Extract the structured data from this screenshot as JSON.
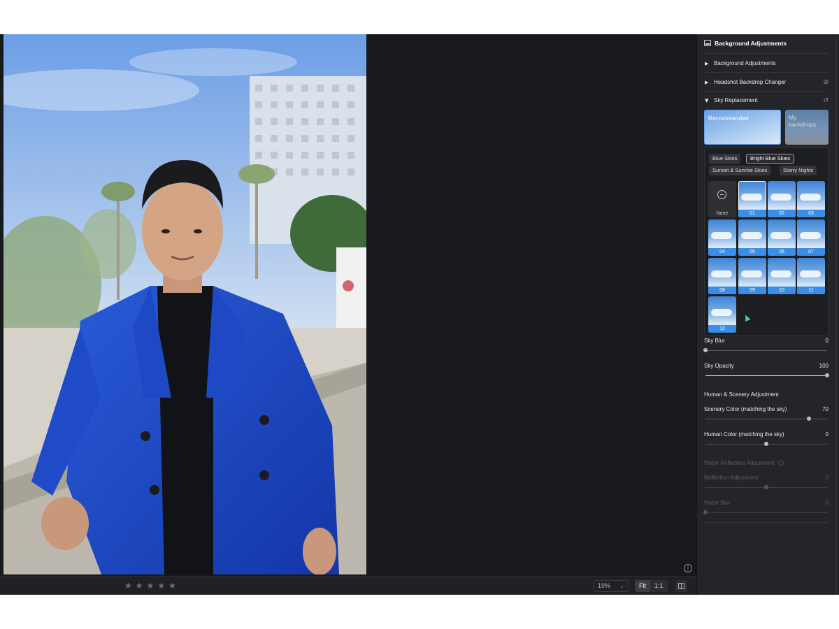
{
  "canvas": {
    "info_icon": "info-icon"
  },
  "bottom_bar": {
    "rating_stars": 5,
    "zoom_value": "19%",
    "fit_label": "Fit",
    "one_to_one_label": "1:1"
  },
  "panel": {
    "title": "Background Adjustments",
    "sections": [
      {
        "label": "Background Adjustments",
        "expanded": false
      },
      {
        "label": "Headshot Backdrop Changer",
        "expanded": false
      },
      {
        "label": "Sky Replacement",
        "expanded": true
      }
    ],
    "source_cards": {
      "recommended": "Recommended",
      "my_backdrops": "My backdrops"
    },
    "categories": [
      "Blue Skies",
      "Bright Blue Skies",
      "Sunset & Sunrise Skies",
      "Starry Nights"
    ],
    "selected_category": "Bright Blue Skies",
    "thumbnails": [
      "None",
      "01",
      "02",
      "03",
      "04",
      "05",
      "06",
      "07",
      "08",
      "09",
      "10",
      "11",
      "12"
    ],
    "selected_thumbnail": "01",
    "sliders": {
      "sky_blur": {
        "label": "Sky Blur",
        "value": "0",
        "level": 0
      },
      "sky_opacity": {
        "label": "Sky Opacity",
        "value": "100",
        "level": 1.0
      }
    },
    "human_scenery": {
      "heading": "Human & Scenery Adjustment",
      "scenery_color": {
        "label": "Scenery Color (matching the sky)",
        "value": "70",
        "level": 0.85
      },
      "human_color": {
        "label": "Human Color (matching the sky)",
        "value": "0",
        "level": 0.5
      }
    },
    "water": {
      "heading": "Water Reflection Adjustment",
      "reflection": {
        "label": "Reflection Adjustment",
        "value": "0",
        "level": 0.5
      },
      "water_blur": {
        "label": "Water Blur",
        "value": "0",
        "level": 0
      }
    },
    "colors": {
      "accent": "#3a8ee8",
      "panel_bg": "#24252a",
      "app_bg": "#18191c"
    }
  }
}
